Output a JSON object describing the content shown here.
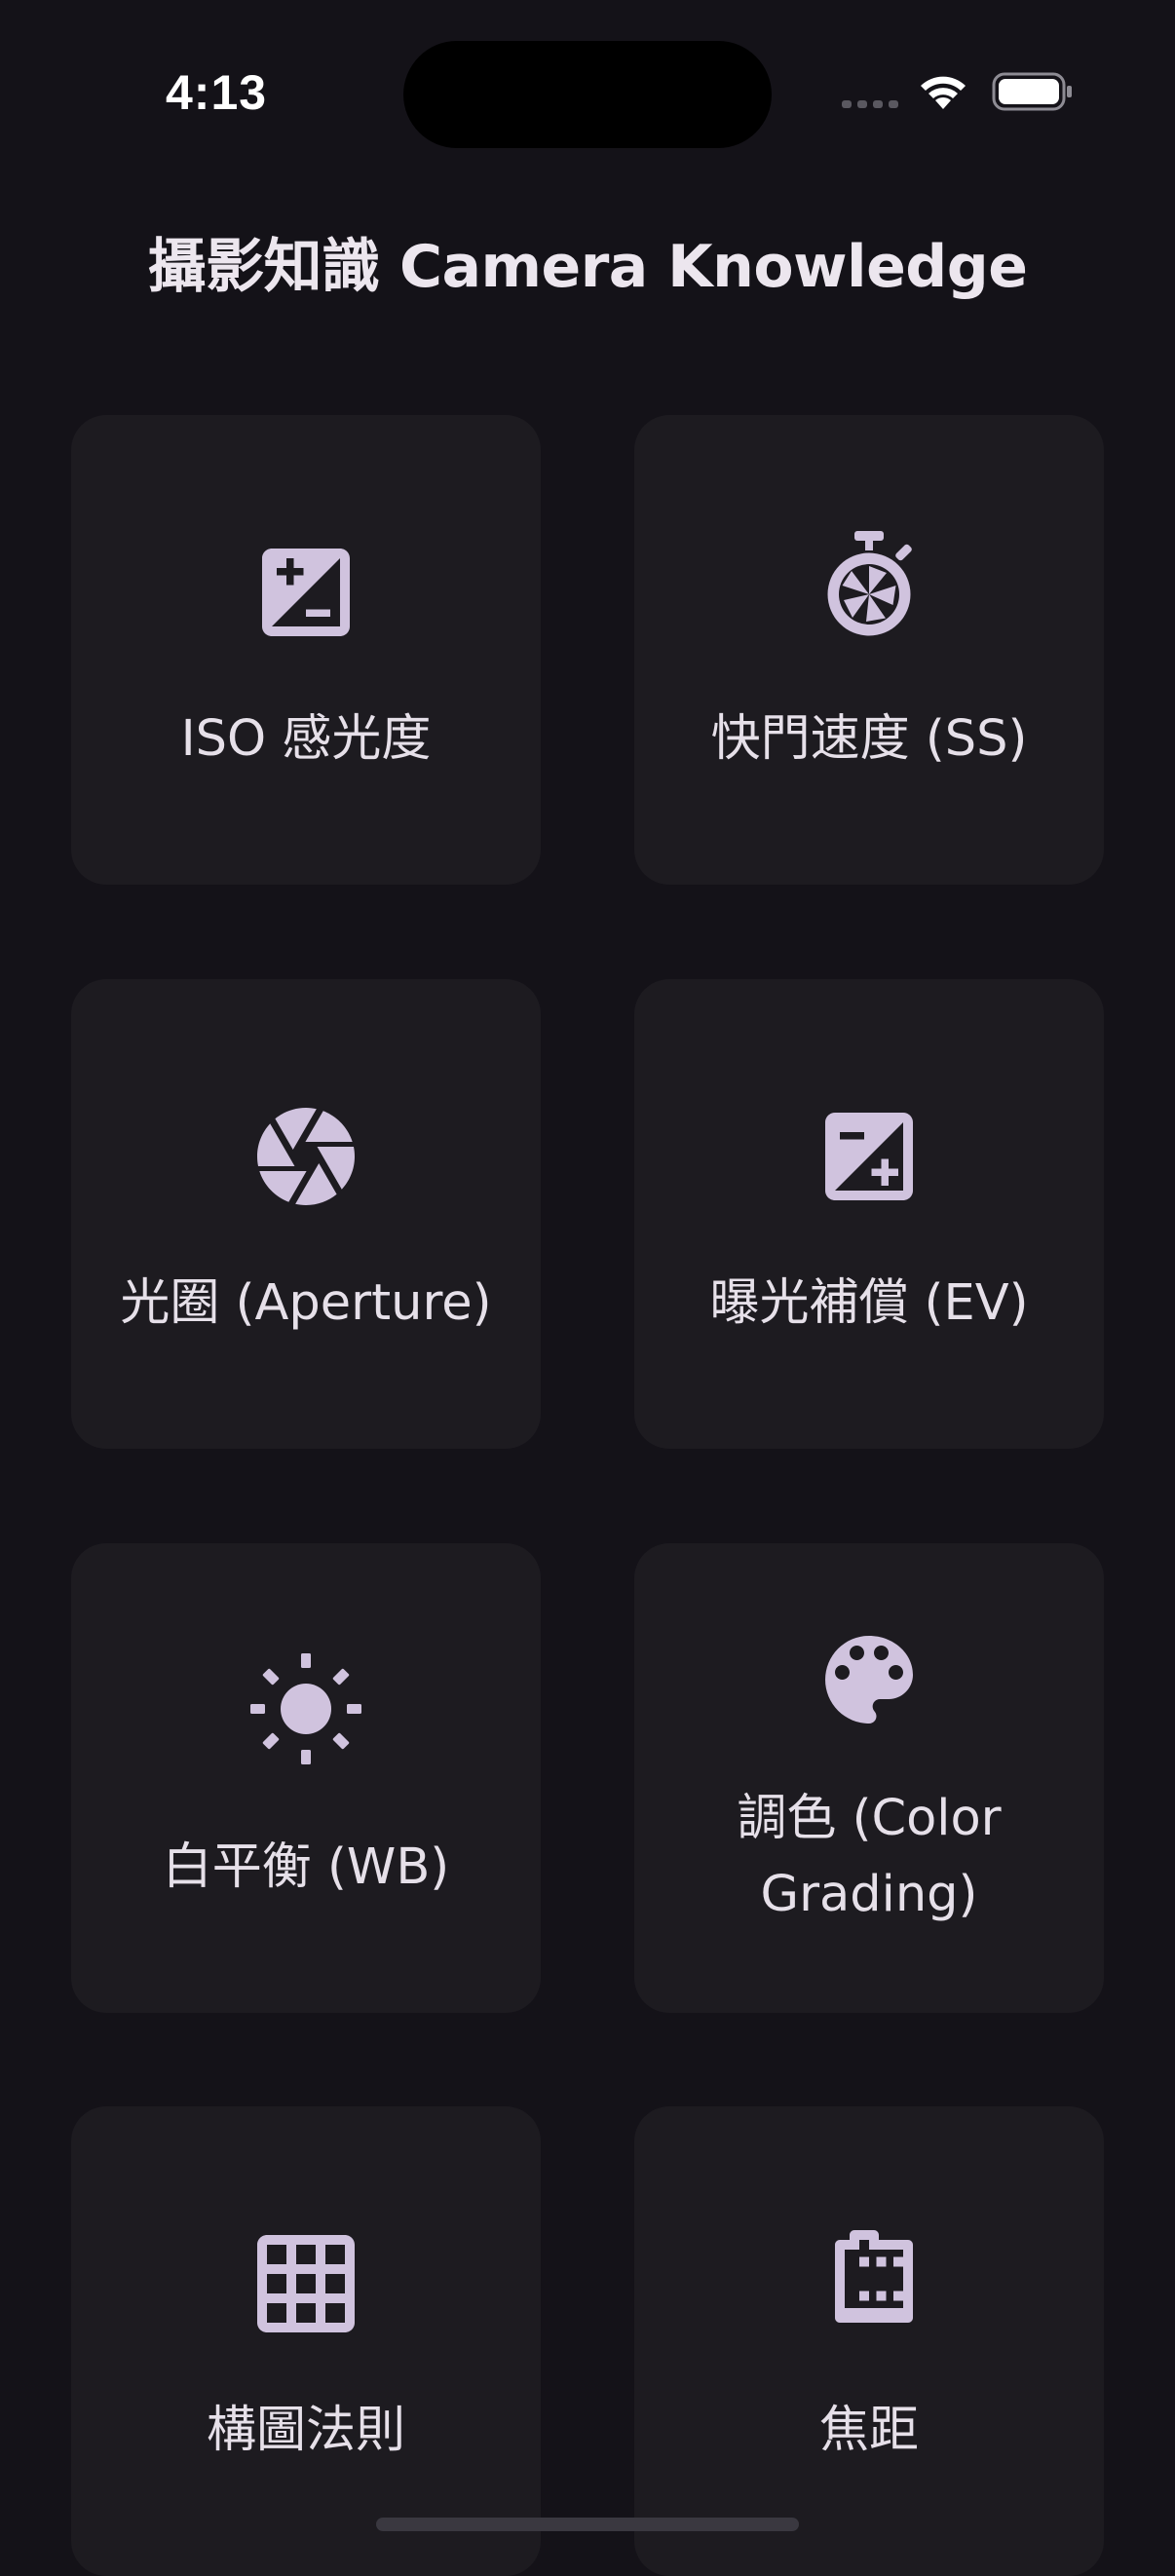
{
  "status_bar": {
    "time": "4:13"
  },
  "page": {
    "title": "攝影知識 Camera Knowledge"
  },
  "cards": [
    {
      "label": "ISO 感光度",
      "icon": "exposure-icon"
    },
    {
      "label": "快門速度 (SS)",
      "icon": "shutter-timer-icon"
    },
    {
      "label": "光圈 (Aperture)",
      "icon": "aperture-icon"
    },
    {
      "label": "曝光補償 (EV)",
      "icon": "exposure-compensation-icon"
    },
    {
      "label": "白平衡 (WB)",
      "icon": "sun-icon"
    },
    {
      "label": "調色 (Color Grading)",
      "icon": "palette-icon"
    },
    {
      "label": "構圖法則",
      "icon": "grid-icon"
    },
    {
      "label": "焦距",
      "icon": "film-icon"
    }
  ],
  "colors": {
    "background": "#141218",
    "card": "#1d1b20",
    "icon": "#d0c3de",
    "text": "#e6e0e9"
  }
}
